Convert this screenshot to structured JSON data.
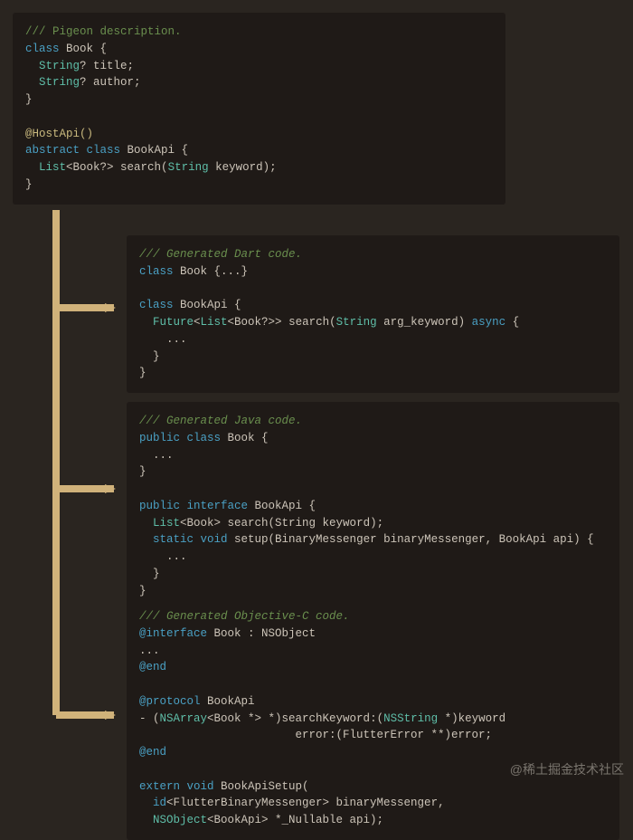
{
  "source": {
    "l1": "/// Pigeon description.",
    "l2a": "class",
    "l2b": " Book {",
    "l3a": "  String",
    "l3b": "? title;",
    "l4a": "  String",
    "l4b": "? author;",
    "l5": "}",
    "l6": "",
    "l7": "@HostApi()",
    "l8a": "abstract",
    "l8b": " class",
    "l8c": " BookApi {",
    "l9a": "  List",
    "l9b": "<Book?> ",
    "l9c": "search",
    "l9d": "(",
    "l9e": "String",
    "l9f": " keyword);",
    "l10": "}"
  },
  "dart": {
    "l1": "/// Generated Dart code.",
    "l2a": "class",
    "l2b": " Book {...}",
    "l3": "",
    "l4a": "class",
    "l4b": " BookApi {",
    "l5a": "  Future",
    "l5b": "<",
    "l5c": "List",
    "l5d": "<Book?>> ",
    "l5e": "search",
    "l5f": "(",
    "l5g": "String",
    "l5h": " arg_keyword) ",
    "l5i": "async",
    "l5j": " {",
    "l6": "    ...",
    "l7": "  }",
    "l8": "}"
  },
  "java": {
    "l1": "/// Generated Java code.",
    "l2a": "public",
    "l2b": " class",
    "l2c": " Book {",
    "l3": "  ...",
    "l4": "}",
    "l5": "",
    "l6a": "public",
    "l6b": " interface",
    "l6c": " BookApi {",
    "l7a": "  List",
    "l7b": "<Book> ",
    "l7c": "search",
    "l7d": "(String keyword);",
    "l8a": "  static",
    "l8b": " void",
    "l8c": " setup",
    "l8d": "(BinaryMessenger binaryMessenger, BookApi api) {",
    "l9": "    ...",
    "l10": "  }",
    "l11": "}"
  },
  "objc": {
    "l1": "/// Generated Objective-C code.",
    "l2a": "@interface",
    "l2b": " Book : NSObject",
    "l3": "...",
    "l4": "@end",
    "l5": "",
    "l6a": "@protocol",
    "l6b": " BookApi",
    "l7a": "- (",
    "l7b": "NSArray",
    "l7c": "<Book *> *)",
    "l7d": "searchKeyword",
    "l7e": ":(",
    "l7f": "NSString",
    "l7g": " *)keyword",
    "l8a": "                       error:(FlutterError **)error;",
    "l9": "@end",
    "l10": "",
    "l11a": "extern",
    "l11b": " void",
    "l11c": " BookApiSetup(",
    "l12a": "  id",
    "l12b": "<FlutterBinaryMessenger> binaryMessenger,",
    "l13a": "  NSObject",
    "l13b": "<BookApi> *_Nullable api);"
  },
  "watermark": "@稀土掘金技术社区",
  "arrow_color": "#d0b27a"
}
